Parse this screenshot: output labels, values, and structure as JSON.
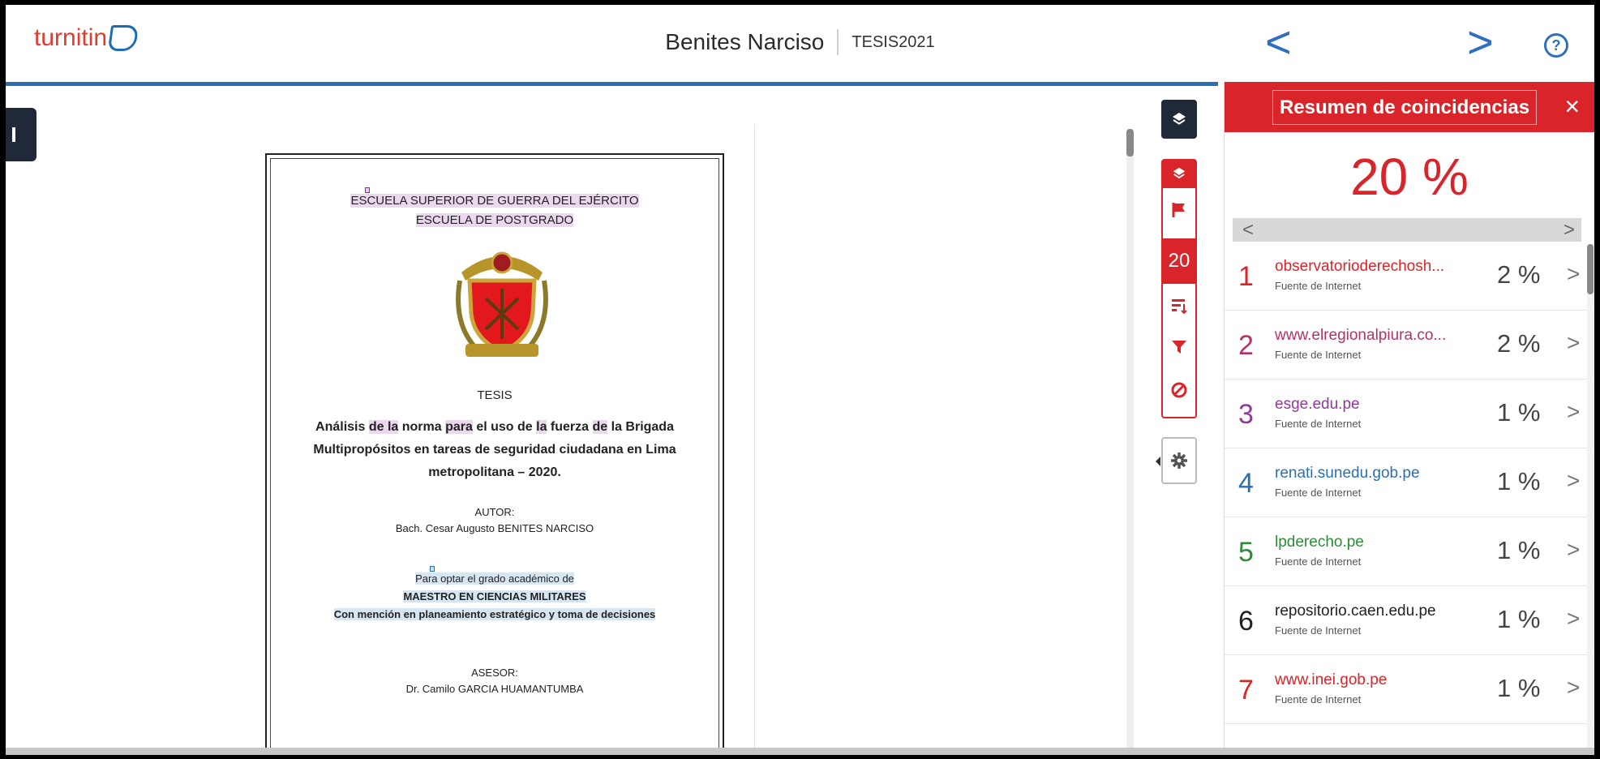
{
  "header": {
    "logo_text": "turnitin",
    "title": "Benites Narciso",
    "subtitle": "TESIS2021",
    "prev_label": "<",
    "next_label": ">",
    "help_label": "?"
  },
  "document": {
    "lines": {
      "school": "ESCUELA SUPERIOR DE GUERRA DEL EJÉRCITO",
      "postgrad": "ESCUELA DE POSTGRADO",
      "tesis": "TESIS",
      "title1_a": "Análisis ",
      "title1_b": "de la",
      "title1_c": " norma ",
      "title1_d": "para",
      "title1_e": " el uso de ",
      "title1_f": "la",
      "title1_g": " fuerza ",
      "title1_h": "de",
      "title1_i": " la Brigada",
      "title2": "Multipropósitos en tareas de seguridad ciudadana en Lima",
      "title3": "metropolitana – 2020.",
      "author_label": "AUTOR:",
      "author": "Bach. Cesar Augusto BENITES NARCISO",
      "degree_intro": "Para optar el grado académico de",
      "degree": "MAESTRO EN CIENCIAS MILITARES",
      "mention": "Con mención en planeamiento estratégico y toma de decisiones",
      "advisor_label": "ASESOR:",
      "advisor": "Dr. Camilo GARCIA HUAMANTUMBA"
    }
  },
  "tools": {
    "score": "20"
  },
  "panel": {
    "title": "Resumen de coincidencias",
    "close": "×",
    "score": "20 %",
    "pager_prev": "<",
    "pager_next": ">",
    "sources": [
      {
        "num": "1",
        "name": "observatorioderechosh...",
        "type": "Fuente de Internet",
        "pct": "2 %",
        "color": "#d9252a"
      },
      {
        "num": "2",
        "name": "www.elregionalpiura.co...",
        "type": "Fuente de Internet",
        "pct": "2 %",
        "color": "#b5316a"
      },
      {
        "num": "3",
        "name": "esge.edu.pe",
        "type": "Fuente de Internet",
        "pct": "1 %",
        "color": "#8e3a96"
      },
      {
        "num": "4",
        "name": "renati.sunedu.gob.pe",
        "type": "Fuente de Internet",
        "pct": "1 %",
        "color": "#2a6fb3"
      },
      {
        "num": "5",
        "name": "lpderecho.pe",
        "type": "Fuente de Internet",
        "pct": "1 %",
        "color": "#2e8b3a"
      },
      {
        "num": "6",
        "name": "repositorio.caen.edu.pe",
        "type": "Fuente de Internet",
        "pct": "1 %",
        "color": "#222222"
      },
      {
        "num": "7",
        "name": "www.inei.gob.pe",
        "type": "Fuente de Internet",
        "pct": "1 %",
        "color": "#d9252a"
      }
    ]
  },
  "icons": {
    "layers": "layers-icon",
    "flag": "flag-icon",
    "sort": "sort-icon",
    "filter": "filter-icon",
    "exclude": "exclude-icon",
    "settings": "gear-icon"
  }
}
